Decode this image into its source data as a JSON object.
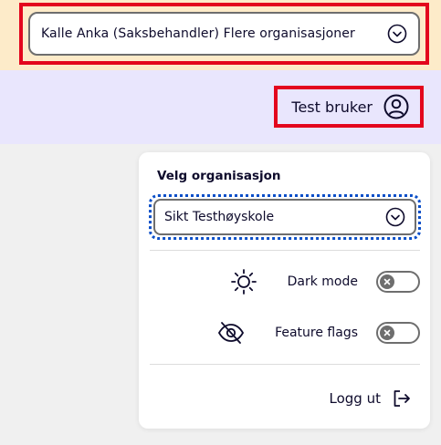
{
  "header": {
    "organisation_select_label": "Kalle Anka (Saksbehandler) Flere organisasjoner"
  },
  "user_menu": {
    "user_button_label": "Test bruker"
  },
  "menu": {
    "heading": "Velg organisasjon",
    "institution_select_label": "Sikt Testhøyskole",
    "dark_mode_label": "Dark mode",
    "dark_mode_on": false,
    "feature_flags_label": "Feature flags",
    "feature_flags_on": false,
    "logout_label": "Logg ut"
  },
  "icons": {
    "org_chevron": "chevron-down-circle-icon",
    "user": "user-circle-icon",
    "inst_chevron": "chevron-down-circle-icon",
    "dark_mode": "sun-icon",
    "feature_flags": "eye-off-icon",
    "toggle_off": "x-icon",
    "logout": "logout-arrow-icon"
  },
  "colors": {
    "banner_bg": "#fdebc9",
    "user_bar_bg": "#e9e6fd",
    "highlight_outline": "#e3061d",
    "focus_outline": "#0b4fc8",
    "text": "#0e0b2c"
  }
}
